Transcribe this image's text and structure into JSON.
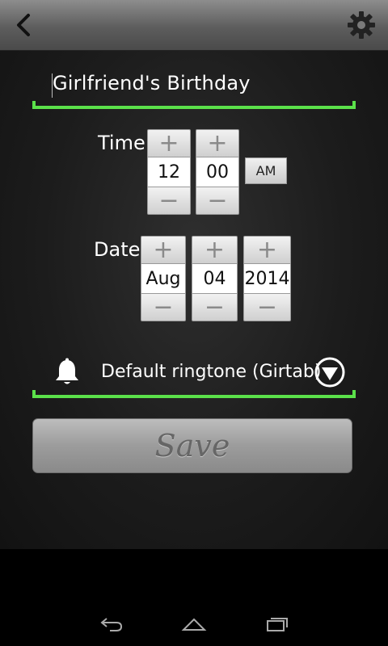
{
  "header": {
    "back_icon": "chevron-left-icon",
    "settings_icon": "gear-icon"
  },
  "reminder": {
    "title": "Girlfriend's Birthday"
  },
  "time": {
    "label": "Time",
    "hour": "12",
    "minute": "00",
    "ampm": "AM",
    "plus": "+",
    "minus": "−"
  },
  "date": {
    "label": "Date",
    "month": "Aug",
    "day": "04",
    "year": "2014",
    "plus": "+",
    "minus": "−"
  },
  "ringtone": {
    "icon": "bell-icon",
    "label": "Default ringtone (Girtab)",
    "dropdown_icon": "dropdown-arrow-icon"
  },
  "actions": {
    "save_label": "Save"
  },
  "colors": {
    "accent_green": "#5be14a",
    "header_gray": "#6b6b6b",
    "background_dark": "#1c1c1c"
  },
  "navbar": {
    "back_icon": "nav-back-icon",
    "home_icon": "nav-home-icon",
    "recents_icon": "nav-recents-icon"
  }
}
